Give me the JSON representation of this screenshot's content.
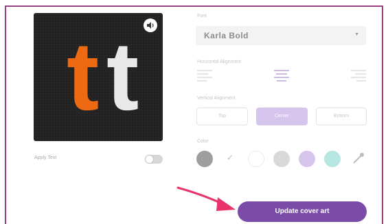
{
  "cover": {
    "letter_1": "t",
    "letter_2": "t",
    "letter_1_color": "#ee6a12",
    "letter_2_color": "#e9e9e9",
    "background": "#222222",
    "audio_icon": "speaker-icon"
  },
  "apply_text": {
    "label": "Apply Text",
    "toggle_on": false
  },
  "font": {
    "label": "Font",
    "selected": "Karla Bold",
    "chevron_icon": "chevron-down-icon"
  },
  "horizontal_alignment": {
    "label": "Horizontal Alignment",
    "options": [
      "align-left-icon",
      "align-center-icon",
      "align-right-icon"
    ],
    "selected": "align-center-icon"
  },
  "vertical_alignment": {
    "label": "Vertical Alignment",
    "options": [
      "Top",
      "Center",
      "Bottom"
    ],
    "selected": "Center"
  },
  "color": {
    "label": "Color",
    "swatches": [
      "#9e9e9e",
      "#ffffff",
      "#d9d9d9",
      "#d7c4ec",
      "#b6e6e0"
    ],
    "selected_index": 0,
    "check_icon": "check-icon",
    "picker_icon": "eyedropper-icon"
  },
  "update_button": {
    "label": "Update cover art",
    "color": "#7a4ca8"
  },
  "annotation": {
    "arrow_color": "#e8336b",
    "frame_color": "#9a3f82"
  }
}
